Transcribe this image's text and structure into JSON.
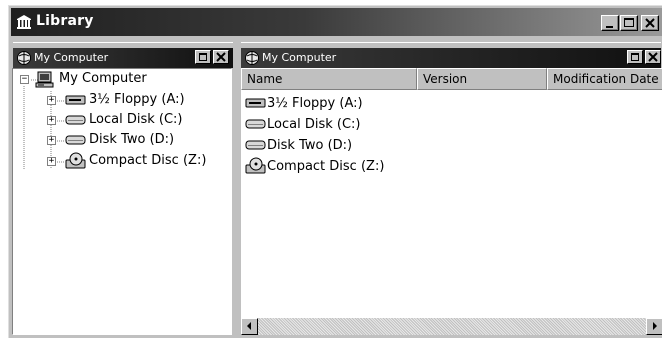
{
  "window": {
    "title": "Library",
    "icon": "library-icon"
  },
  "tree_pane": {
    "title": "My Computer",
    "icon": "my-computer-pane-icon",
    "root": {
      "label": "My Computer",
      "expander": "−",
      "icon": "computer-icon"
    },
    "items": [
      {
        "label": "3½ Floppy (A:)",
        "expander": "+",
        "icon": "floppy-drive-icon"
      },
      {
        "label": "Local Disk (C:)",
        "expander": "+",
        "icon": "hard-disk-icon"
      },
      {
        "label": "Disk Two (D:)",
        "expander": "+",
        "icon": "hard-disk-icon"
      },
      {
        "label": "Compact Disc (Z:)",
        "expander": "+",
        "icon": "cd-drive-icon"
      }
    ]
  },
  "list_pane": {
    "title": "My Computer",
    "icon": "my-computer-pane-icon",
    "columns": [
      "Name",
      "Version",
      "Modification Date"
    ],
    "items": [
      {
        "label": "3½ Floppy (A:)",
        "icon": "floppy-drive-icon"
      },
      {
        "label": "Local Disk (C:)",
        "icon": "hard-disk-icon"
      },
      {
        "label": "Disk Two (D:)",
        "icon": "hard-disk-icon"
      },
      {
        "label": "Compact Disc (Z:)",
        "icon": "cd-drive-icon"
      }
    ]
  }
}
